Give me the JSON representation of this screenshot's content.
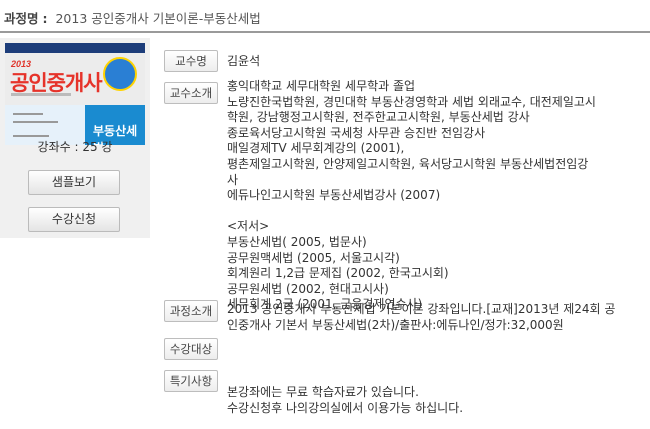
{
  "header": {
    "label": "과정명",
    "separator": ":",
    "course_title": "2013 공인중개사 기본이론-부동산세법"
  },
  "book": {
    "year_tag": "2013",
    "title": "공인중개사",
    "lower_text": "부동산세법"
  },
  "lecture_count": "강좌수 : 25 강",
  "buttons": {
    "sample": "샘플보기",
    "enroll": "수강신청"
  },
  "labels": {
    "professor": "교수명",
    "professor_intro": "교수소개",
    "course_intro": "과정소개",
    "target": "수강대상",
    "special": "특기사항"
  },
  "professor_name": "김윤석",
  "professor_intro_lines": [
    "홍익대학교 세무대학원 세무학과 졸업",
    "노량진한국법학원, 경민대학 부동산경영학과 세법 외래교수, 대전제일고시",
    "학원, 강남행정고시학원, 전주한교고시학원, 부동산세법 강사",
    "종로육서당고시학원 국세청 사무관 승진반 전임강사",
    "매일경제TV 세무회계강의 (2001),",
    "평촌제일고시학원, 안양제일고시학원, 육서당고시학원 부동산세법전임강",
    "사",
    "에듀나인고시학원 부동산세법강사 (2007)",
    "",
    "<저서>",
    "부동산세법( 2005, 법문사)",
    "공무원맥세법 (2005, 서울고시각)",
    "회계원리 1,2급 문제집 (2002, 한국고시회)",
    "공무원세법 (2002, 현대고시사)",
    "세무회계 2급 (2001, 금융경제연수사)"
  ],
  "course_intro_lines": [
    "2013 공인중개사 부동산세법 기본이론 강좌입니다.[교재]2013년 제24회 공",
    "인중개사 기본서 부동산세법(2차)/출판사:에듀나인/정가:32,000원"
  ],
  "special_lines": [
    "본강좌에는 무료 학습자료가 있습니다.",
    "수강신청후 나의강의실에서 이용가능 하십니다."
  ]
}
